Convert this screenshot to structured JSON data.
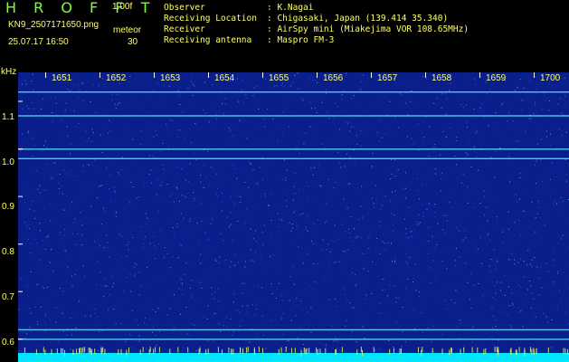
{
  "header": {
    "app_name": "H R O F F T",
    "version": "1.00f",
    "file_name": "KN9_2507171650.png",
    "mode": "meteor",
    "timestamp": "25.07.17 16:50",
    "count": "30"
  },
  "info": {
    "labels": [
      "Observer",
      "Receiving Location",
      "Receiver",
      "Receiving antenna"
    ],
    "values": [
      ": K.Nagai",
      ": Chigasaki, Japan (139.414 35.340)",
      ": AirSpy mini (Miakejima VOR 108.65MHz)",
      ": Maspro FM-3"
    ]
  },
  "colors": {
    "text": "#ffff66",
    "app_name": "#7cff3a",
    "background": "#000000",
    "waterfall": "#0a1f8c",
    "noise_floor": "#00e5ff"
  },
  "chart_data": {
    "type": "heatmap",
    "ylabel": "kHz",
    "x_ticks": [
      "1651",
      "1652",
      "1653",
      "1654",
      "1655",
      "1656",
      "1657",
      "1658",
      "1659",
      "1700"
    ],
    "y_ticks": [
      "1.1",
      "1.0",
      "0.9",
      "0.8",
      "0.7",
      "0.6"
    ],
    "y_tick_values": [
      1.1,
      1.0,
      0.9,
      0.8,
      0.7,
      0.6
    ],
    "x_range_minutes": [
      16.5,
      26.65
    ],
    "ylim": [
      0.57,
      1.16
    ],
    "carrier_lines_khz": [
      1.12,
      1.07,
      1.0,
      0.98,
      0.62,
      0.6
    ],
    "grid": false
  }
}
